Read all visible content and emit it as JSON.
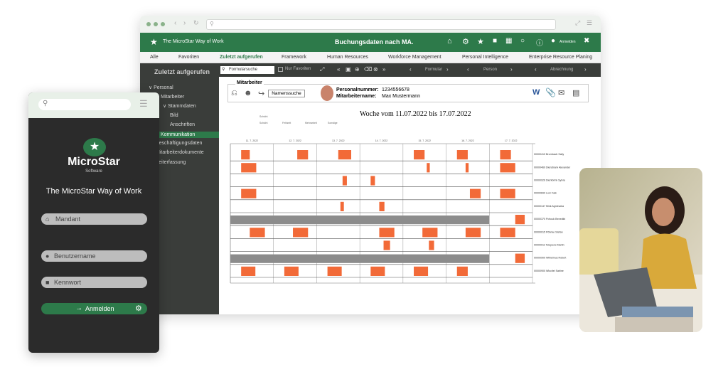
{
  "colors": {
    "brand": "#2d7a4a",
    "accent": "#f26a38",
    "dark": "#3a3d3a"
  },
  "window": {
    "header_left": "The MicroStar Way of Work",
    "header_center": "Buchungsdaten nach MA.",
    "user_label": "Anmelden",
    "menu": [
      "Alle",
      "Favoriten",
      "Zuletzt aufgerufen",
      "Framework",
      "Human Resources",
      "Workforce Management",
      "Personal Intelligence",
      "Enterprise Resource Planing"
    ],
    "sidebar_title": "Zuletzt aufgerufen",
    "tree": [
      {
        "label": "Personal",
        "indent": 0,
        "prefix": "v"
      },
      {
        "label": "Mitarbeiter",
        "indent": 1,
        "prefix": "v"
      },
      {
        "label": "Stammdaten",
        "indent": 2,
        "prefix": "v"
      },
      {
        "label": "Bild",
        "indent": 3,
        "prefix": ""
      },
      {
        "label": "Anschriften",
        "indent": 3,
        "prefix": ""
      },
      {
        "label": "Kommunikation",
        "indent": 3,
        "prefix": "",
        "selected": true
      },
      {
        "label": "Beschäftigungsdaten",
        "indent": 1,
        "prefix": ""
      },
      {
        "label": "Mitarbeiterdokumente",
        "indent": 1,
        "prefix": ""
      },
      {
        "label": "Zeiterfassung",
        "indent": 1,
        "prefix": ""
      }
    ],
    "toolbar": {
      "search_value": "Formularsuche",
      "favorites_label": "Nur Favoriten",
      "formular": "Formular",
      "person": "Person",
      "abrechnung": "Abrechnung"
    },
    "mitarbeiter": {
      "section": "Mitarbeiter",
      "name_search": "Namenssuche",
      "personalnummer_label": "Personalnummer:",
      "personalnummer": "1234556678",
      "name_label": "Mitarbeitername:",
      "name": "Max Mustermann"
    },
    "chart": {
      "title": "Woche vom 11.07.2022 bis 17.07.2022",
      "dates": [
        "11. 7. 2022",
        "12. 7. 2022",
        "13. 7. 2022",
        "14. 7. 2022",
        "15. 7. 2022",
        "16. 7. 2022",
        "17. 7. 2022"
      ],
      "legend": [
        "Schicht",
        "Fehlzeit",
        "Mehrarbeit",
        "Sonstige"
      ],
      "employees": [
        "00000410 Brombach Sally",
        "00000469 Dienstrank Alexander",
        "00000926 Dierkbrink Sylvia",
        "00000690 Lorz Falk",
        "00000147 Mink Agnieszka",
        "00000370 Pohouk Benedikt",
        "00000015 Pöhnke Stefan",
        "00000011 Telepecic Martin",
        "00000900 Wilhelmus Robert",
        "00000900 Wlocitel Sabine"
      ]
    }
  },
  "phone": {
    "search_placeholder": "",
    "brand": "MicroStar",
    "brand_sub": "Software",
    "tagline": "The MicroStar Way of Work",
    "field_mandant": "Mandant",
    "field_user": "Benutzername",
    "field_password": "Kennwort",
    "login": "Anmelden"
  }
}
